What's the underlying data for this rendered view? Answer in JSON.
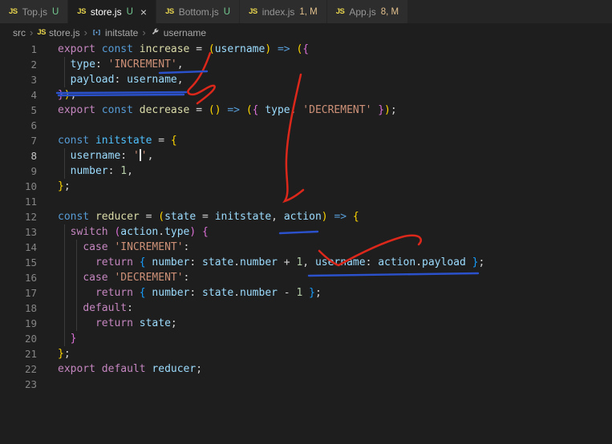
{
  "palette": {
    "git_untracked_green": "#73c991",
    "git_modified_orange": "#e2c08d",
    "annotation_red": "#dc271b",
    "annotation_blue": "#2b52cc",
    "editor_background": "#1e1e1e",
    "tabbar_background": "#252526"
  },
  "tabs": [
    {
      "name": "Top.js",
      "status": "U",
      "active": false
    },
    {
      "name": "store.js",
      "status": "U",
      "active": true,
      "close": "×"
    },
    {
      "name": "Bottom.js",
      "status": "U",
      "active": false
    },
    {
      "name": "index.js",
      "status": "1, M",
      "active": false
    },
    {
      "name": "App.js",
      "status": "8, M",
      "active": false
    }
  ],
  "breadcrumbs": {
    "separator": "›",
    "items": [
      "src",
      "store.js",
      "initstate",
      "username"
    ]
  },
  "editor": {
    "indent_guides": [
      {
        "x": 80,
        "from": 2,
        "to": 3
      },
      {
        "x": 80,
        "from": 8,
        "to": 9
      },
      {
        "x": 80,
        "from": 13,
        "to": 20
      },
      {
        "x": 95,
        "from": 14,
        "to": 19
      }
    ],
    "lines": [
      {
        "n": 1,
        "t": [
          [
            "ctrl",
            "export"
          ],
          [
            "pun",
            " "
          ],
          [
            "kw",
            "const"
          ],
          [
            "pun",
            " "
          ],
          [
            "fn",
            "increase"
          ],
          [
            "pun",
            " = "
          ],
          [
            "b1",
            "("
          ],
          [
            "var",
            "username"
          ],
          [
            "b1",
            ")"
          ],
          [
            "pun",
            " "
          ],
          [
            "kw",
            "=>"
          ],
          [
            "pun",
            " "
          ],
          [
            "b1",
            "("
          ],
          [
            "b2",
            "{"
          ]
        ]
      },
      {
        "n": 2,
        "t": [
          [
            "pun",
            "  "
          ],
          [
            "var",
            "type"
          ],
          [
            "pun",
            ": "
          ],
          [
            "str",
            "'INCREMENT'"
          ],
          [
            "pun",
            ","
          ]
        ]
      },
      {
        "n": 3,
        "t": [
          [
            "pun",
            "  "
          ],
          [
            "var",
            "payload"
          ],
          [
            "pun",
            ": "
          ],
          [
            "var",
            "username"
          ],
          [
            "pun",
            ","
          ]
        ]
      },
      {
        "n": 4,
        "t": [
          [
            "b2",
            "}"
          ],
          [
            "b1",
            ")"
          ],
          [
            "pun",
            ";"
          ]
        ]
      },
      {
        "n": 5,
        "t": [
          [
            "ctrl",
            "export"
          ],
          [
            "pun",
            " "
          ],
          [
            "kw",
            "const"
          ],
          [
            "pun",
            " "
          ],
          [
            "fn",
            "decrease"
          ],
          [
            "pun",
            " = "
          ],
          [
            "b1",
            "("
          ],
          [
            "b1",
            ")"
          ],
          [
            "pun",
            " "
          ],
          [
            "kw",
            "=>"
          ],
          [
            "pun",
            " "
          ],
          [
            "b1",
            "("
          ],
          [
            "b2",
            "{"
          ],
          [
            "pun",
            " "
          ],
          [
            "var",
            "type"
          ],
          [
            "pun",
            ": "
          ],
          [
            "str",
            "'DECREMENT'"
          ],
          [
            "pun",
            " "
          ],
          [
            "b2",
            "}"
          ],
          [
            "b1",
            ")"
          ],
          [
            "pun",
            ";"
          ]
        ]
      },
      {
        "n": 6,
        "t": []
      },
      {
        "n": 7,
        "t": [
          [
            "kw",
            "const"
          ],
          [
            "pun",
            " "
          ],
          [
            "cvar",
            "initstate"
          ],
          [
            "pun",
            " = "
          ],
          [
            "b1",
            "{"
          ]
        ]
      },
      {
        "n": 8,
        "a": true,
        "t": [
          [
            "pun",
            "  "
          ],
          [
            "var",
            "username"
          ],
          [
            "pun",
            ": "
          ],
          [
            "str",
            "'"
          ],
          [
            "cursor",
            ""
          ],
          [
            "str",
            "'"
          ],
          [
            "pun",
            ","
          ]
        ]
      },
      {
        "n": 9,
        "t": [
          [
            "pun",
            "  "
          ],
          [
            "var",
            "number"
          ],
          [
            "pun",
            ": "
          ],
          [
            "num",
            "1"
          ],
          [
            "pun",
            ","
          ]
        ]
      },
      {
        "n": 10,
        "t": [
          [
            "b1",
            "}"
          ],
          [
            "pun",
            ";"
          ]
        ]
      },
      {
        "n": 11,
        "t": []
      },
      {
        "n": 12,
        "t": [
          [
            "kw",
            "const"
          ],
          [
            "pun",
            " "
          ],
          [
            "fn",
            "reducer"
          ],
          [
            "pun",
            " = "
          ],
          [
            "b1",
            "("
          ],
          [
            "var",
            "state"
          ],
          [
            "pun",
            " = "
          ],
          [
            "var",
            "initstate"
          ],
          [
            "pun",
            ", "
          ],
          [
            "var",
            "action"
          ],
          [
            "b1",
            ")"
          ],
          [
            "pun",
            " "
          ],
          [
            "kw",
            "=>"
          ],
          [
            "pun",
            " "
          ],
          [
            "b1",
            "{"
          ]
        ]
      },
      {
        "n": 13,
        "t": [
          [
            "pun",
            "  "
          ],
          [
            "ctrl",
            "switch"
          ],
          [
            "pun",
            " "
          ],
          [
            "b2",
            "("
          ],
          [
            "var",
            "action"
          ],
          [
            "pun",
            "."
          ],
          [
            "var",
            "type"
          ],
          [
            "b2",
            ")"
          ],
          [
            "pun",
            " "
          ],
          [
            "b2",
            "{"
          ]
        ]
      },
      {
        "n": 14,
        "t": [
          [
            "pun",
            "    "
          ],
          [
            "ctrl",
            "case"
          ],
          [
            "pun",
            " "
          ],
          [
            "str",
            "'INCREMENT'"
          ],
          [
            "pun",
            ":"
          ]
        ]
      },
      {
        "n": 15,
        "t": [
          [
            "pun",
            "      "
          ],
          [
            "ctrl",
            "return"
          ],
          [
            "pun",
            " "
          ],
          [
            "b3",
            "{"
          ],
          [
            "pun",
            " "
          ],
          [
            "var",
            "number"
          ],
          [
            "pun",
            ": "
          ],
          [
            "var",
            "state"
          ],
          [
            "pun",
            "."
          ],
          [
            "var",
            "number"
          ],
          [
            "pun",
            " + "
          ],
          [
            "num",
            "1"
          ],
          [
            "pun",
            ", "
          ],
          [
            "var",
            "username"
          ],
          [
            "pun",
            ": "
          ],
          [
            "var",
            "action"
          ],
          [
            "pun",
            "."
          ],
          [
            "var",
            "payload"
          ],
          [
            "pun",
            " "
          ],
          [
            "b3",
            "}"
          ],
          [
            "pun",
            ";"
          ]
        ]
      },
      {
        "n": 16,
        "t": [
          [
            "pun",
            "    "
          ],
          [
            "ctrl",
            "case"
          ],
          [
            "pun",
            " "
          ],
          [
            "str",
            "'DECREMENT'"
          ],
          [
            "pun",
            ":"
          ]
        ]
      },
      {
        "n": 17,
        "t": [
          [
            "pun",
            "      "
          ],
          [
            "ctrl",
            "return"
          ],
          [
            "pun",
            " "
          ],
          [
            "b3",
            "{"
          ],
          [
            "pun",
            " "
          ],
          [
            "var",
            "number"
          ],
          [
            "pun",
            ": "
          ],
          [
            "var",
            "state"
          ],
          [
            "pun",
            "."
          ],
          [
            "var",
            "number"
          ],
          [
            "pun",
            " - "
          ],
          [
            "num",
            "1"
          ],
          [
            "pun",
            " "
          ],
          [
            "b3",
            "}"
          ],
          [
            "pun",
            ";"
          ]
        ]
      },
      {
        "n": 18,
        "t": [
          [
            "pun",
            "    "
          ],
          [
            "ctrl",
            "default"
          ],
          [
            "pun",
            ":"
          ]
        ]
      },
      {
        "n": 19,
        "t": [
          [
            "pun",
            "      "
          ],
          [
            "ctrl",
            "return"
          ],
          [
            "pun",
            " "
          ],
          [
            "var",
            "state"
          ],
          [
            "pun",
            ";"
          ]
        ]
      },
      {
        "n": 20,
        "t": [
          [
            "pun",
            "  "
          ],
          [
            "b2",
            "}"
          ]
        ]
      },
      {
        "n": 21,
        "t": [
          [
            "b1",
            "}"
          ],
          [
            "pun",
            ";"
          ]
        ]
      },
      {
        "n": 22,
        "t": [
          [
            "ctrl",
            "export"
          ],
          [
            "pun",
            " "
          ],
          [
            "ctrl",
            "default"
          ],
          [
            "pun",
            " "
          ],
          [
            "var",
            "reducer"
          ],
          [
            "pun",
            ";"
          ]
        ]
      },
      {
        "n": 23,
        "t": []
      }
    ]
  },
  "annotations": {
    "strokes": [
      {
        "name": "red-pen-stroke",
        "color_key": "annotation_red",
        "width": 2.5,
        "paths": [
          "M262 66 C256 83 251 93 245 101 C238 111 231 113 236 117 C245 122 260 105 267 107 C271 110 257 121 246 129",
          "M375 93 C367 128 358 166 357 199 C356 223 362 240 355 251 C364 248 372 242 378 237",
          "M398 313 C406 321 414 328 422 331 C440 321 472 304 500 296 C510 293 519 293 523 296 C526 299 525 302 522 305"
        ]
      },
      {
        "name": "blue-underline-stroke",
        "color_key": "annotation_blue",
        "width": 2.4,
        "paths": [
          "M199 91 L258 89",
          "M71 116 L232 115",
          "M73 119 L229 118",
          "M349 291 L396 289",
          "M385 344 L596 341"
        ]
      }
    ]
  }
}
